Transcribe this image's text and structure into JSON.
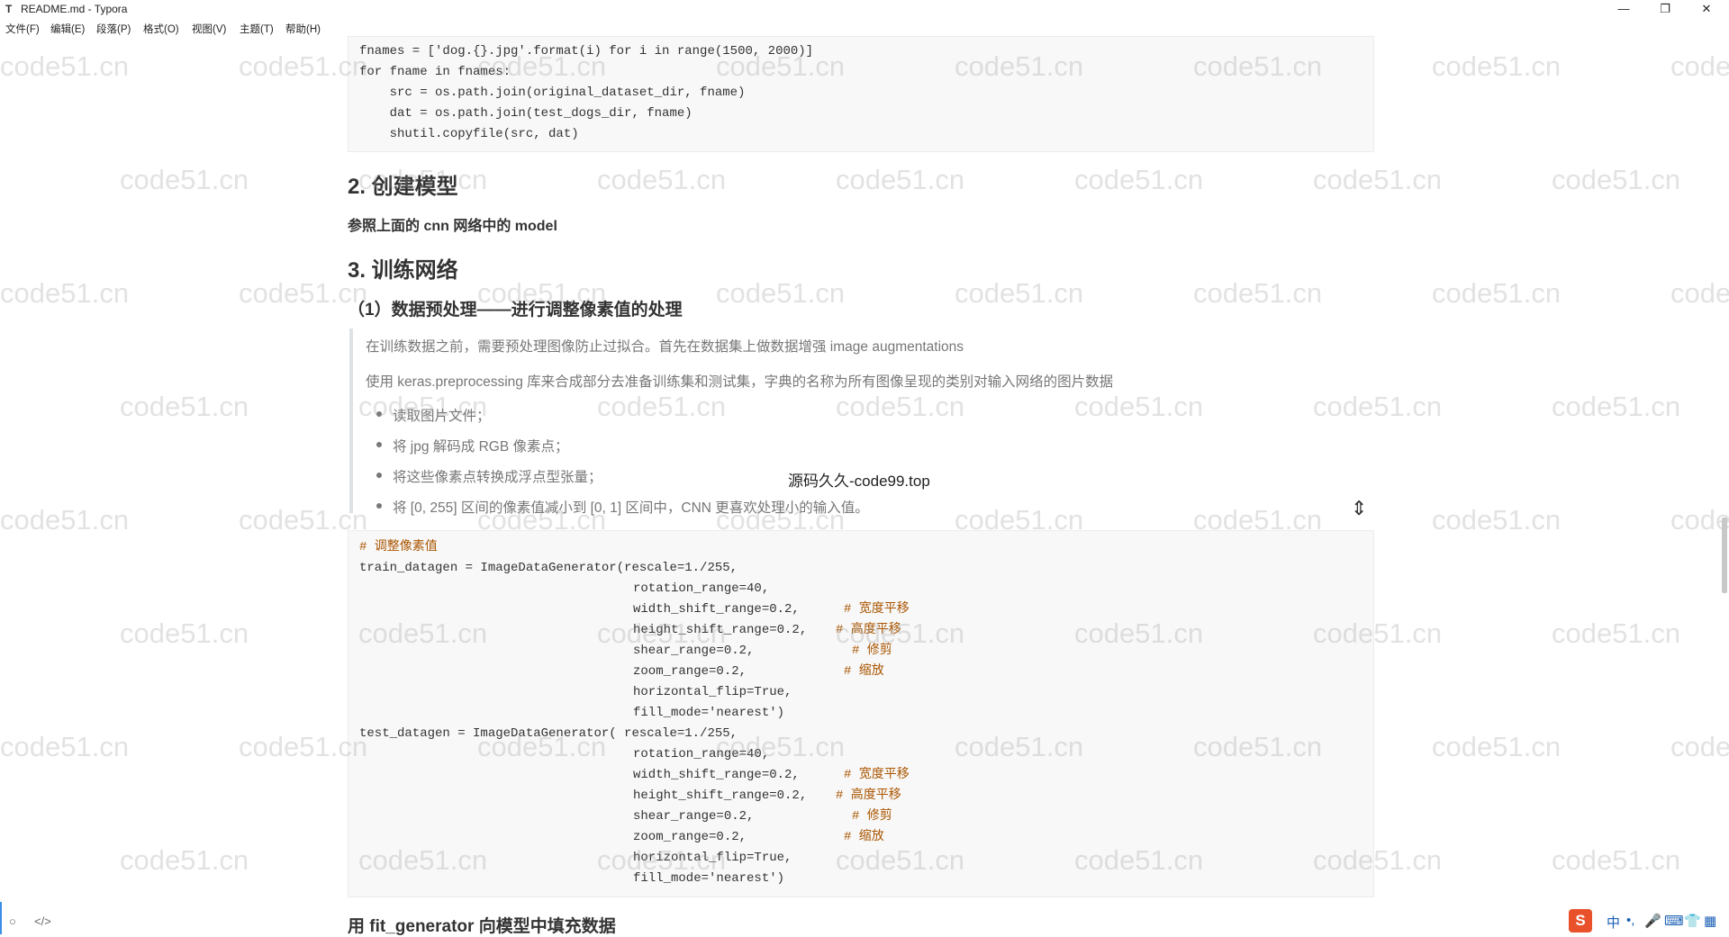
{
  "window": {
    "title": "README.md - Typora",
    "app_icon": "T",
    "minimize": "—",
    "restore": "❐",
    "close": "✕"
  },
  "menu": [
    "文件(F)",
    "编辑(E)",
    "段落(P)",
    "格式(O)",
    "视图(V)",
    "主题(T)",
    "帮助(H)"
  ],
  "code1": {
    "lines": [
      "fnames = ['dog.{}.jpg'.format(i) for i in range(1500, 2000)]",
      "for fname in fnames:",
      "    src = os.path.join(original_dataset_dir, fname)",
      "    dat = os.path.join(test_dogs_dir, fname)",
      "    shutil.copyfile(src, dat)"
    ]
  },
  "section2": {
    "heading": "2. 创建模型",
    "text": "参照上面的 cnn 网络中的 model"
  },
  "section3": {
    "heading": "3. 训练网络",
    "subheading": "（1）数据预处理——进行调整像素值的处理"
  },
  "quote": {
    "p1": "在训练数据之前，需要预处理图像防止过拟合。首先在数据集上做数据增强 image augmentations",
    "p2": "使用 keras.preprocessing 库来合成部分去准备训练集和测试集，字典的名称为所有图像呈现的类别对输入网络的图片数据",
    "items": [
      "读取图片文件；",
      "将 jpg 解码成 RGB 像素点；",
      "将这些像素点转换成浮点型张量；",
      "将 [0, 255] 区间的像素值减小到 [0, 1] 区间中，CNN 更喜欢处理小的输入值。"
    ]
  },
  "overlay_text": "源码久久-code99.top",
  "code2": {
    "comment_title": "# 调整像素值",
    "train_line": "train_datagen = ImageDataGenerator(rescale=1./255,",
    "test_line": "test_datagen = ImageDataGenerator( rescale=1./255,",
    "args": [
      "rotation_range=40,",
      "width_shift_range=0.2,",
      "height_shift_range=0.2,",
      "shear_range=0.2,",
      "zoom_range=0.2,",
      "horizontal_flip=True,",
      "fill_mode='nearest')"
    ],
    "comments": [
      "# 宽度平移",
      "# 高度平移",
      "# 修剪",
      "# 缩放"
    ]
  },
  "next_heading": "用 fit_generator 向模型中填充数据",
  "watermark": "code51.cn",
  "status": {
    "outline_icon": "○",
    "source_icon": "</>"
  },
  "ime": {
    "logo": "S",
    "items": [
      "中",
      "•,",
      "🎤",
      "⌨",
      "👕",
      "▦"
    ]
  }
}
